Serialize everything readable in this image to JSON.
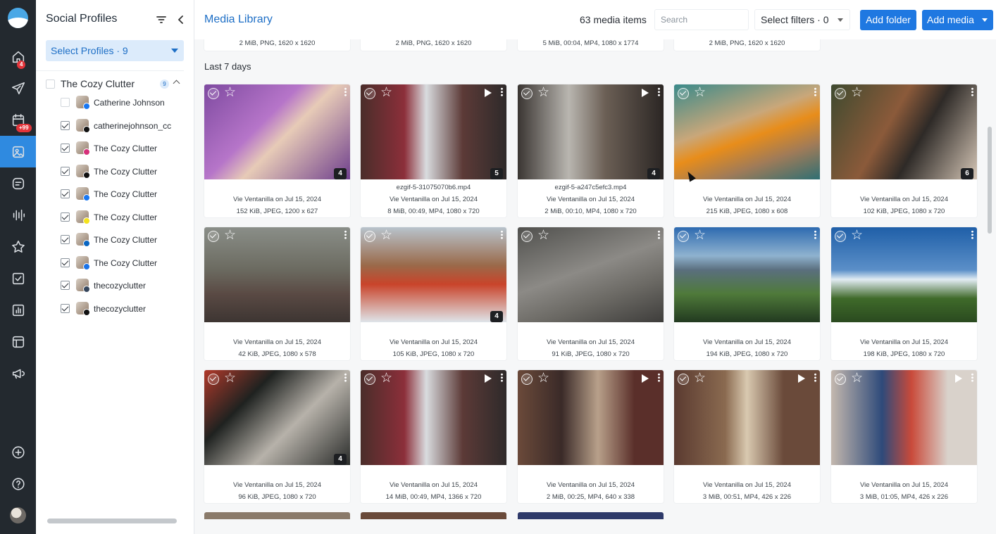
{
  "rail": {
    "badges": {
      "home": "4",
      "calendar": "+99"
    },
    "icons": [
      "home-icon",
      "send-icon",
      "calendar-icon",
      "media-library-icon",
      "inbox-icon",
      "listening-icon",
      "star-icon",
      "tasks-icon",
      "reports-icon",
      "layout-icon",
      "megaphone-icon",
      "add-icon",
      "help-icon"
    ]
  },
  "panel": {
    "title": "Social Profiles",
    "select_label": "Select Profiles · 9",
    "group_name": "The Cozy Clutter",
    "group_count": "9",
    "profiles": [
      {
        "name": "Catherine Johnson",
        "checked": false,
        "network": "facebook",
        "color": "#1877f2"
      },
      {
        "name": "catherinejohnson_cc",
        "checked": true,
        "network": "threads",
        "color": "#111111"
      },
      {
        "name": "The Cozy Clutter",
        "checked": true,
        "network": "instagram",
        "color": "#d6307a"
      },
      {
        "name": "The Cozy Clutter",
        "checked": true,
        "network": "x",
        "color": "#111111"
      },
      {
        "name": "The Cozy Clutter",
        "checked": true,
        "network": "facebook",
        "color": "#1877f2"
      },
      {
        "name": "The Cozy Clutter",
        "checked": true,
        "network": "snapchat",
        "color": "#f4e21b"
      },
      {
        "name": "The Cozy Clutter",
        "checked": true,
        "network": "linkedin",
        "color": "#0a66c2"
      },
      {
        "name": "The Cozy Clutter",
        "checked": true,
        "network": "google-business",
        "color": "#1a73e8"
      },
      {
        "name": "thecozyclutter",
        "checked": true,
        "network": "tumblr",
        "color": "#35465c"
      },
      {
        "name": "thecozyclutter",
        "checked": true,
        "network": "tiktok",
        "color": "#111111"
      }
    ]
  },
  "header": {
    "title": "Media Library",
    "count": "63 media items",
    "search_placeholder": "Search",
    "filters_label": "Select filters · 0",
    "add_folder": "Add folder",
    "add_media": "Add media"
  },
  "previous_row_meta": [
    "2 MiB, PNG, 1620 x 1620",
    "2 MiB, PNG, 1620 x 1620",
    "5 MiB, 00:04, MP4, 1080 x 1774",
    "2 MiB, PNG, 1620 x 1620"
  ],
  "section_label": "Last 7 days",
  "media": [
    {
      "by": "Vie Ventanilla on Jul 15, 2024",
      "meta": "152 KiB, JPEG, 1200 x 627",
      "file": "",
      "badge": "4",
      "video": false,
      "bg": "linear-gradient(135deg,#7e4aa0,#b675c9 40%,#e7cbb7 55%,#6f3f8d)"
    },
    {
      "by": "Vie Ventanilla on Jul 15, 2024",
      "meta": "8 MiB, 00:49, MP4, 1080 x 720",
      "file": "ezgif-5-31075070b6.mp4",
      "badge": "5",
      "video": true,
      "bg": "linear-gradient(90deg,#4a2d2a,#8c2f3a 30%,#d9dcdf 45%,#5c3a37 70%,#2e2a2a)"
    },
    {
      "by": "Vie Ventanilla on Jul 15, 2024",
      "meta": "2 MiB, 00:10, MP4, 1080 x 720",
      "file": "ezgif-5-a247c5efc3.mp4",
      "badge": "4",
      "video": true,
      "bg": "linear-gradient(90deg,#3a3532,#b9b6b0 35%,#6b5f55 60%,#2b2624)"
    },
    {
      "by": "Vie Ventanilla on Jul 15, 2024",
      "meta": "215 KiB, JPEG, 1080 x 608",
      "file": "",
      "badge": "",
      "video": false,
      "bg": "linear-gradient(160deg,#3a8a8a,#c9a77a 40%,#e88d1a 55%,#a07b58 75%,#2f6f73)"
    },
    {
      "by": "Vie Ventanilla on Jul 15, 2024",
      "meta": "102 KiB, JPEG, 1080 x 720",
      "file": "",
      "badge": "6",
      "video": false,
      "bg": "linear-gradient(120deg,#3e4a2f,#8b5a3a 40%,#2e2a27 60%,#d4c5b5)"
    },
    {
      "by": "Vie Ventanilla on Jul 15, 2024",
      "meta": "42 KiB, JPEG, 1080 x 578",
      "file": "",
      "badge": "",
      "video": false,
      "bg": "linear-gradient(180deg,#8a8e88,#6b6a60 45%,#5a4a44 70%,#3d3532)"
    },
    {
      "by": "Vie Ventanilla on Jul 15, 2024",
      "meta": "105 KiB, JPEG, 1080 x 720",
      "file": "",
      "badge": "4",
      "video": false,
      "bg": "linear-gradient(180deg,#b8c3cc,#9a6a4a 40%,#c9442a 60%,#dfe5ea)"
    },
    {
      "by": "Vie Ventanilla on Jul 15, 2024",
      "meta": "91 KiB, JPEG, 1080 x 720",
      "file": "",
      "badge": "",
      "video": false,
      "bg": "linear-gradient(160deg,#50504d,#8c8a86 45%,#6b6964 70%,#3e3d3b)"
    },
    {
      "by": "Vie Ventanilla on Jul 15, 2024",
      "meta": "194 KiB, JPEG, 1080 x 720",
      "file": "",
      "badge": "",
      "video": false,
      "bg": "linear-gradient(180deg,#2d6ab0,#8fb2cf 30%,#5a6f7e 45%,#4f7a3a 70%,#223a20)"
    },
    {
      "by": "Vie Ventanilla on Jul 15, 2024",
      "meta": "198 KiB, JPEG, 1080 x 720",
      "file": "",
      "badge": "",
      "video": false,
      "bg": "linear-gradient(180deg,#1f5fa8,#5b8fc8 45%,#e2ecf3 55%,#3f6a2a 75%,#2a4a1f)"
    },
    {
      "by": "Vie Ventanilla on Jul 15, 2024",
      "meta": "96 KiB, JPEG, 1080 x 720",
      "file": "",
      "badge": "4",
      "video": false,
      "bg": "linear-gradient(135deg,#b0392a,#1f2220 30%,#b7b2aa 60%,#2a2c2a)"
    },
    {
      "by": "Vie Ventanilla on Jul 15, 2024",
      "meta": "14 MiB, 00:49, MP4, 1366 x 720",
      "file": "",
      "badge": "",
      "video": true,
      "bg": "linear-gradient(90deg,#4a2d2a,#8c2f3a 30%,#d9dcdf 45%,#5c3a37 70%,#2e2a2a)"
    },
    {
      "by": "Vie Ventanilla on Jul 15, 2024",
      "meta": "2 MiB, 00:25, MP4, 640 x 338",
      "file": "",
      "badge": "",
      "video": true,
      "bg": "linear-gradient(90deg,#6b4a3a,#3a2a28 30%,#b8a08a 55%,#5a2f2a 80%)"
    },
    {
      "by": "Vie Ventanilla on Jul 15, 2024",
      "meta": "3 MiB, 00:51, MP4, 426 x 226",
      "file": "",
      "badge": "",
      "video": true,
      "bg": "linear-gradient(90deg,#5a3a30,#8a6a50 35%,#d9c9b0 50%,#6a4a3a 75%)"
    },
    {
      "by": "Vie Ventanilla on Jul 15, 2024",
      "meta": "3 MiB, 01:05, MP4, 426 x 226",
      "file": "",
      "badge": "",
      "video": true,
      "bg": "linear-gradient(90deg,#c4b8ae,#2e4a7a 35%,#c94a3a 55%,#d9d2cb 80%)"
    }
  ]
}
